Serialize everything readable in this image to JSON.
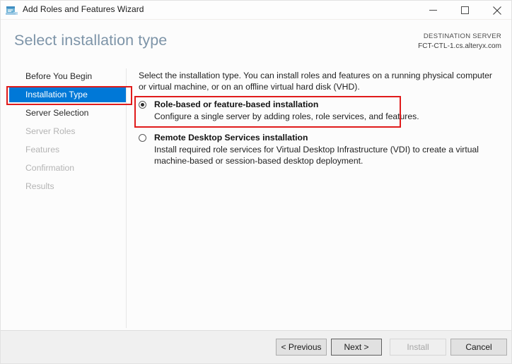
{
  "window": {
    "title": "Add Roles and Features Wizard",
    "icon": "server-wizard-icon",
    "controls": {
      "minimize": "minimize-icon",
      "maximize": "maximize-icon",
      "close": "close-icon"
    }
  },
  "header": {
    "page_title": "Select installation type",
    "destination_label": "DESTINATION SERVER",
    "destination_server": "FCT-CTL-1.cs.alteryx.com"
  },
  "navigation": {
    "items": [
      {
        "label": "Before You Begin",
        "state": "enabled"
      },
      {
        "label": "Installation Type",
        "state": "selected"
      },
      {
        "label": "Server Selection",
        "state": "enabled"
      },
      {
        "label": "Server Roles",
        "state": "disabled"
      },
      {
        "label": "Features",
        "state": "disabled"
      },
      {
        "label": "Confirmation",
        "state": "disabled"
      },
      {
        "label": "Results",
        "state": "disabled"
      }
    ]
  },
  "main": {
    "intro": "Select the installation type. You can install roles and features on a running physical computer or virtual machine, or on an offline virtual hard disk (VHD).",
    "options": [
      {
        "title": "Role-based or feature-based installation",
        "description": "Configure a single server by adding roles, role services, and features.",
        "selected": true
      },
      {
        "title": "Remote Desktop Services installation",
        "description": "Install required role services for Virtual Desktop Infrastructure (VDI) to create a virtual machine-based or session-based desktop deployment.",
        "selected": false
      }
    ]
  },
  "footer": {
    "previous": "< Previous",
    "next": "Next >",
    "install": "Install",
    "cancel": "Cancel",
    "install_enabled": false
  },
  "annotations": {
    "accent_color": "#e01b1b",
    "highlight_color": "#0078d7",
    "title_color": "#7d94a8"
  }
}
